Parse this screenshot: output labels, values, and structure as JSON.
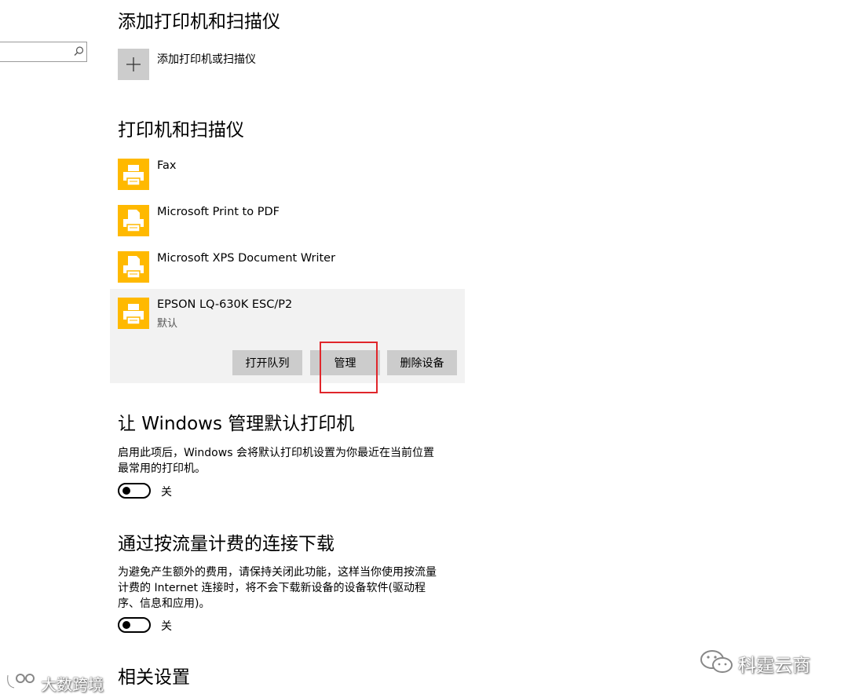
{
  "add_section": {
    "title": "添加打印机和扫描仪",
    "add_label": "添加打印机或扫描仪"
  },
  "printers_section": {
    "title": "打印机和扫描仪",
    "items": [
      {
        "name": "Fax",
        "status": ""
      },
      {
        "name": "Microsoft Print to PDF",
        "status": ""
      },
      {
        "name": "Microsoft XPS Document Writer",
        "status": ""
      },
      {
        "name": "EPSON LQ-630K ESC/P2",
        "status": "默认"
      }
    ],
    "buttons": {
      "open_queue": "打开队列",
      "manage": "管理",
      "remove": "删除设备"
    }
  },
  "default_section": {
    "title": "让 Windows 管理默认打印机",
    "desc_line1": "启用此项后，Windows 会将默认打印机设置为你最近在当前位置",
    "desc_line2": "最常用的打印机。",
    "toggle_label": "关"
  },
  "metered_section": {
    "title": "通过按流量计费的连接下载",
    "desc_line1": "为避免产生额外的费用，请保持关闭此功能，这样当你使用按流量",
    "desc_line2": "计费的 Internet 连接时，将不会下载新设备的设备软件(驱动程",
    "desc_line3": "序、信息和应用)。",
    "toggle_label": "关"
  },
  "related_section": {
    "title": "相关设置"
  },
  "watermarks": {
    "left": "大数跨境",
    "right": "科霆云商"
  },
  "colors": {
    "printer_icon": "#ffb900",
    "button_bg": "#cccccc",
    "highlight": "#e0262b",
    "selected_bg": "#f2f2f2"
  }
}
